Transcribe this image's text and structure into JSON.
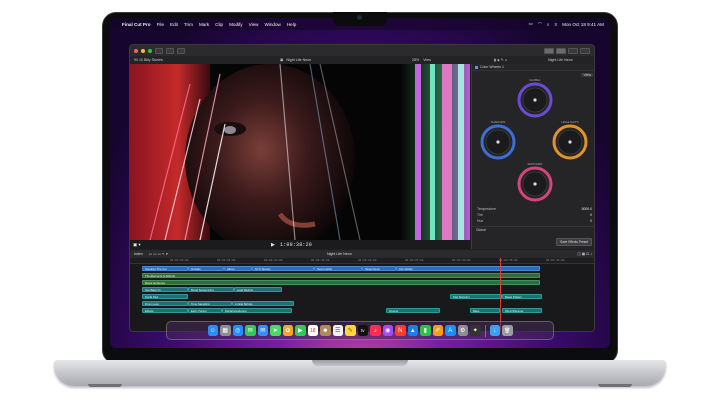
{
  "menubar": {
    "app_name": "Final Cut Pro",
    "menus": [
      "File",
      "Edit",
      "Trim",
      "Mark",
      "Clip",
      "Modify",
      "View",
      "Window",
      "Help"
    ],
    "clock": "Mon Oct 18  9:41 AM"
  },
  "toolbar": {},
  "viewer": {
    "library_label": "90 10 Billy Stories",
    "title": "Night Life Neon",
    "zoom": "28%",
    "view_label": "View",
    "timecode": "1:00:38:20"
  },
  "inspector": {
    "title": "Color Wheels 1",
    "view_label": "View",
    "title_right": "Night Life Neon",
    "wheels": [
      {
        "label": "Global",
        "color": "#8b5cf6"
      },
      {
        "label": "Shadows",
        "color": "#3b82f6"
      },
      {
        "label": "Highlights",
        "color": "#f59e0b"
      },
      {
        "label": "Midtones",
        "color": "#ec4899"
      }
    ],
    "params": [
      {
        "name": "Temperature",
        "value": "5000.0"
      },
      {
        "name": "Tint",
        "value": "0"
      },
      {
        "name": "Hue",
        "value": "0"
      }
    ],
    "global_label": "Global",
    "save_button": "Save Effects Preset"
  },
  "timeline": {
    "index_label": "Index",
    "title": "Night Life Neon",
    "ticks": [
      "00:00:00:00",
      "00:00:05:00",
      "00:00:10:00",
      "00:00:15:00",
      "00:00:20:00",
      "00:00:25:00",
      "00:00:30:00",
      "00:00:35:00",
      "00:00:40:00"
    ],
    "clips": [
      {
        "label": "Spooling The Cut",
        "color": "blue"
      },
      {
        "label": "Outside",
        "color": "blue"
      },
      {
        "label": "Alleys",
        "color": "blue"
      },
      {
        "label": "NYC Streets",
        "color": "blue"
      },
      {
        "label": "Neon Lights",
        "color": "blue"
      },
      {
        "label": "Street Neon",
        "color": "blue"
      },
      {
        "label": "City Nights",
        "color": "blue"
      },
      {
        "label": "The Elements & Attitude",
        "color": "green"
      },
      {
        "label": "Beats Ambience",
        "color": "green"
      },
      {
        "label": "Spy Bass Fx",
        "color": "teal"
      },
      {
        "label": "Mood Sequencing",
        "color": "teal"
      },
      {
        "label": "Lead Melody",
        "color": "teal"
      },
      {
        "label": "Synth Pad",
        "color": "teal"
      },
      {
        "label": "Pad Spinning",
        "color": "teal"
      },
      {
        "label": "Beats Pattern",
        "color": "teal"
      },
      {
        "label": "Drum Loop",
        "color": "teal"
      },
      {
        "label": "Tone Sampling",
        "color": "teal"
      },
      {
        "label": "Lyrical Strings",
        "color": "teal"
      },
      {
        "label": "Effects",
        "color": "teal"
      },
      {
        "label": "Early Tuning",
        "color": "teal"
      },
      {
        "label": "Digital Rendering",
        "color": "teal"
      },
      {
        "label": "Groove",
        "color": "teal"
      },
      {
        "label": "Bass",
        "color": "teal"
      },
      {
        "label": "Wind Shimmer",
        "color": "teal"
      }
    ]
  },
  "dock": {
    "apps": [
      {
        "name": "Finder",
        "glyph": "☺",
        "color": "#2e8df0"
      },
      {
        "name": "Launchpad",
        "glyph": "▦",
        "color": "#8e8e93"
      },
      {
        "name": "Safari",
        "glyph": "◎",
        "color": "#1e90ff"
      },
      {
        "name": "Messages",
        "glyph": "✉",
        "color": "#34c759"
      },
      {
        "name": "Mail",
        "glyph": "✉",
        "color": "#3a8ff7"
      },
      {
        "name": "Maps",
        "glyph": "➤",
        "color": "#4cd964"
      },
      {
        "name": "Photos",
        "glyph": "✿",
        "color": "#f5a623"
      },
      {
        "name": "FaceTime",
        "glyph": "▶",
        "color": "#2ecc55"
      },
      {
        "name": "Calendar",
        "glyph": "18",
        "color": "#ffffff"
      },
      {
        "name": "Contacts",
        "glyph": "☻",
        "color": "#b08a5a"
      },
      {
        "name": "Reminders",
        "glyph": "☰",
        "color": "#f2f2f2"
      },
      {
        "name": "Notes",
        "glyph": "✎",
        "color": "#ffd43b"
      },
      {
        "name": "TV",
        "glyph": "tv",
        "color": "#111111"
      },
      {
        "name": "Music",
        "glyph": "♪",
        "color": "#fa2d55"
      },
      {
        "name": "Podcasts",
        "glyph": "◉",
        "color": "#a44bf2"
      },
      {
        "name": "News",
        "glyph": "N",
        "color": "#ff3b30"
      },
      {
        "name": "Keynote",
        "glyph": "▲",
        "color": "#1c7cf4"
      },
      {
        "name": "Numbers",
        "glyph": "▮",
        "color": "#2fbf4f"
      },
      {
        "name": "Pages",
        "glyph": "✐",
        "color": "#f79b1f"
      },
      {
        "name": "App Store",
        "glyph": "A",
        "color": "#1c8ef5"
      },
      {
        "name": "System Preferences",
        "glyph": "⚙",
        "color": "#8e8e93"
      },
      {
        "name": "Final Cut Pro",
        "glyph": "✦",
        "color": "#333333"
      },
      {
        "name": "Downloads",
        "glyph": "↓",
        "color": "#3ea0f4"
      },
      {
        "name": "Trash",
        "glyph": "🗑",
        "color": "#9a9aa0"
      }
    ]
  }
}
